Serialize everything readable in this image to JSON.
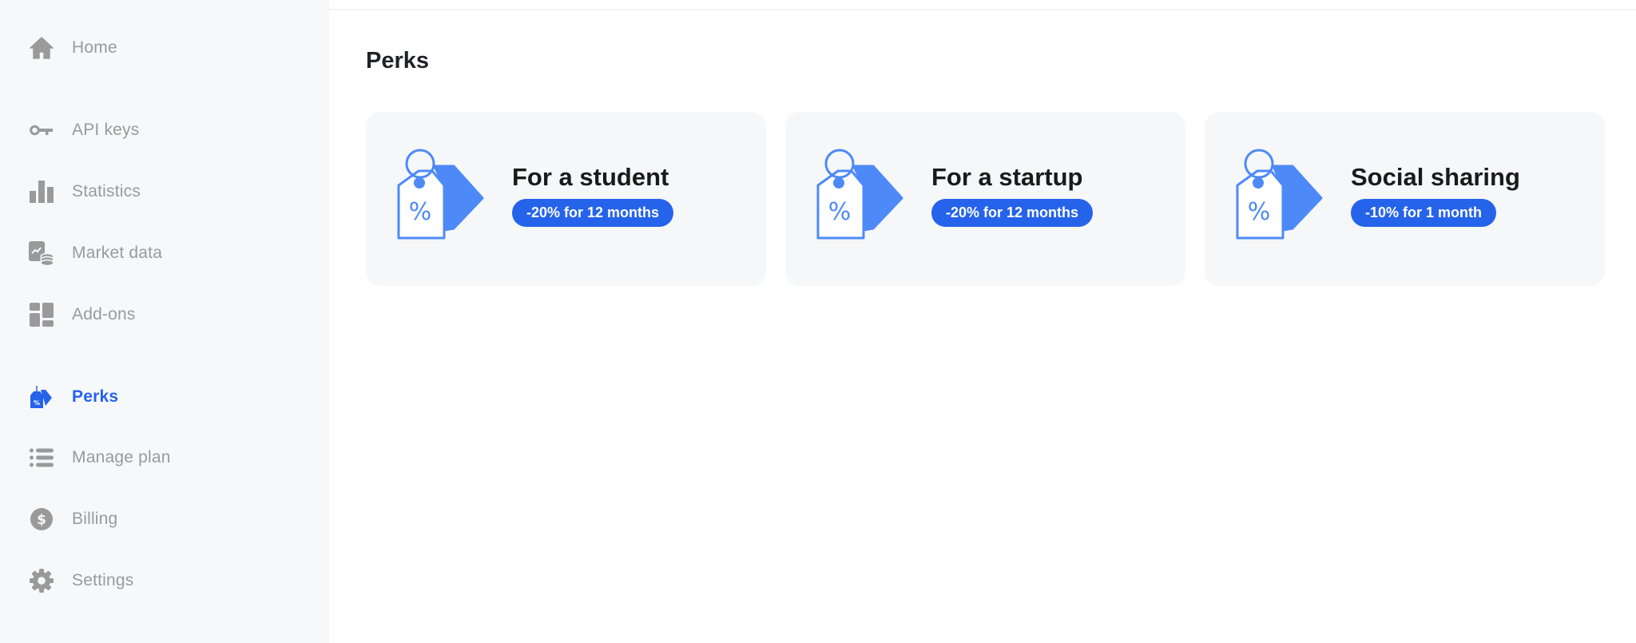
{
  "sidebar": {
    "items": [
      {
        "label": "Home",
        "icon": "home-icon",
        "active": false
      },
      {
        "label": "API keys",
        "icon": "key-icon",
        "active": false
      },
      {
        "label": "Statistics",
        "icon": "bar-chart-icon",
        "active": false
      },
      {
        "label": "Market data",
        "icon": "market-data-icon",
        "active": false
      },
      {
        "label": "Add-ons",
        "icon": "dashboard-icon",
        "active": false
      },
      {
        "label": "Perks",
        "icon": "price-tag-icon",
        "active": true
      },
      {
        "label": "Manage plan",
        "icon": "list-icon",
        "active": false
      },
      {
        "label": "Billing",
        "icon": "dollar-icon",
        "active": false
      },
      {
        "label": "Settings",
        "icon": "gear-icon",
        "active": false
      }
    ]
  },
  "main": {
    "title": "Perks",
    "cards": [
      {
        "title": "For a student",
        "badge": "-20% for 12 months"
      },
      {
        "title": "For a startup",
        "badge": "-20% for 12 months"
      },
      {
        "title": "Social sharing",
        "badge": "-10% for 1 month"
      }
    ]
  },
  "colors": {
    "accent": "#2563eb",
    "tag_icon": "#4d8af8",
    "sidebar_bg": "#f7f8fa",
    "card_bg": "#f6f7f9",
    "muted_text": "#9a9a9a",
    "heading": "#1f2328"
  }
}
